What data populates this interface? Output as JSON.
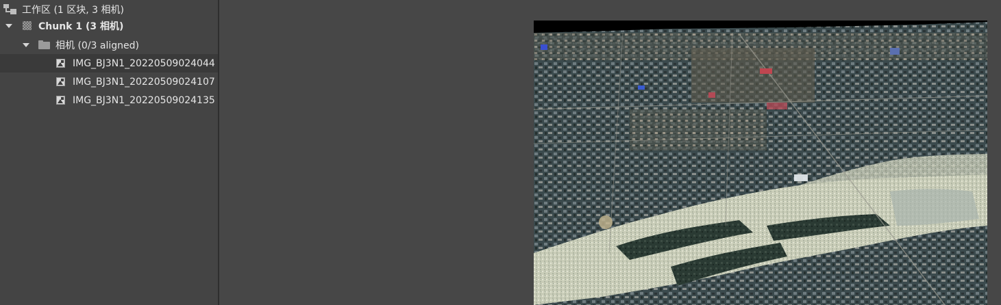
{
  "workspace": {
    "label": "工作区 (1 区块, 3 相机)",
    "chunk": {
      "label": "Chunk 1 (3 相机)",
      "cameras_folder": {
        "label": "相机 (0/3 aligned)",
        "cameras": [
          {
            "name": "IMG_BJ3N1_20220509024044"
          },
          {
            "name": "IMG_BJ3N1_20220509024107"
          },
          {
            "name": "IMG_BJ3N1_20220509024135"
          }
        ]
      }
    }
  },
  "icons": {
    "workspace": "workspace-icon",
    "chunk": "chunk-icon",
    "folder": "folder-icon",
    "camera": "image-icon",
    "expand": "chevron-down-icon"
  },
  "colors": {
    "panel_bg": "#444444",
    "viewport_bg": "#474747",
    "selected_row": "#3a3a3a",
    "text": "#e6e6e6"
  }
}
